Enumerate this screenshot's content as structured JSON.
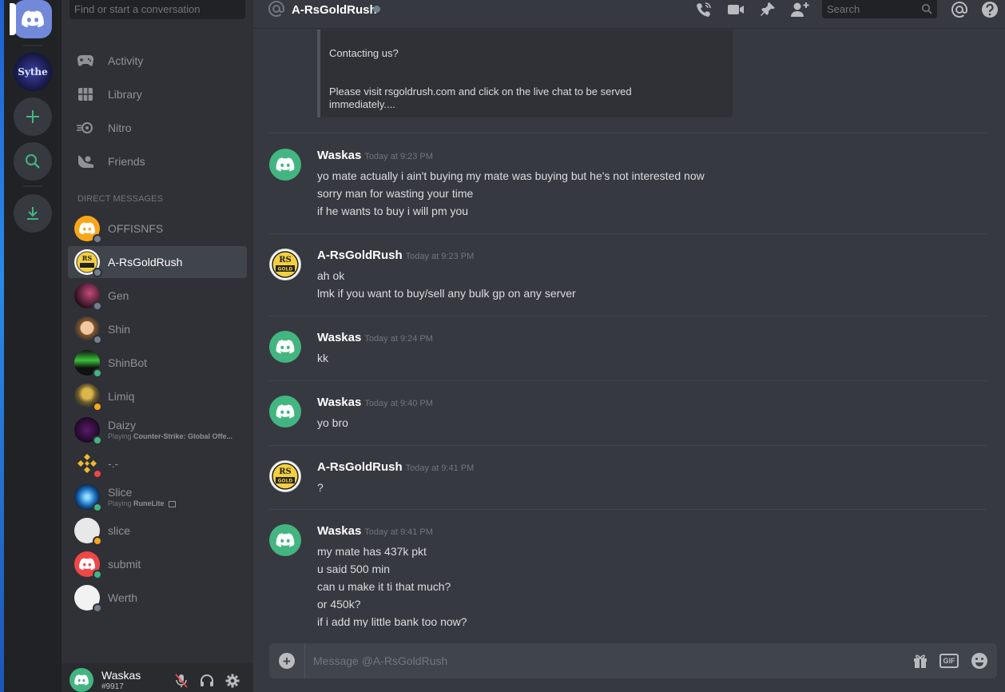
{
  "colors": {
    "accent": "#7289da",
    "online": "#43b581",
    "idle": "#faa61a",
    "dnd": "#f04747",
    "offline": "#747f8d"
  },
  "guilds": {
    "items": [
      {
        "name": "Home",
        "icon": "discord-logo-icon"
      },
      {
        "name": "Sythe",
        "label": "Sythe"
      },
      {
        "name": "Add a Server",
        "icon": "plus-icon"
      },
      {
        "name": "Explore Public Servers",
        "icon": "search-icon"
      },
      {
        "name": "Download Apps",
        "icon": "download-icon"
      }
    ]
  },
  "sidebar": {
    "search_placeholder": "Find or start a conversation",
    "nav": [
      {
        "label": "Activity",
        "icon": "gamepad-icon"
      },
      {
        "label": "Library",
        "icon": "library-icon"
      },
      {
        "label": "Nitro",
        "icon": "nitro-icon"
      },
      {
        "label": "Friends",
        "icon": "friends-icon"
      }
    ],
    "dm_header": "DIRECT MESSAGES",
    "dms": [
      {
        "name": "OFFISNFS",
        "status": "offline"
      },
      {
        "name": "A-RsGoldRush",
        "status": "offline",
        "active": true
      },
      {
        "name": "Gen",
        "status": "offline"
      },
      {
        "name": "Shin",
        "status": "offline"
      },
      {
        "name": "ShinBot",
        "status": "online"
      },
      {
        "name": "Limiq",
        "status": "idle"
      },
      {
        "name": "Daizy",
        "status": "online",
        "activity_prefix": "Playing ",
        "activity": "Counter-Strike: Global Offe..."
      },
      {
        "name": "-.-",
        "status": "dnd"
      },
      {
        "name": "Slice",
        "status": "online",
        "activity_prefix": "Playing ",
        "activity": "RuneLite"
      },
      {
        "name": "slice",
        "status": "idle"
      },
      {
        "name": "submit",
        "status": "online"
      },
      {
        "name": "Werth",
        "status": "offline"
      }
    ]
  },
  "user": {
    "name": "Waskas",
    "tag": "#9917"
  },
  "header": {
    "channel": "A-RsGoldRush",
    "search_placeholder": "Search"
  },
  "embed": {
    "line1": "Contacting us?",
    "line2": "Please visit rsgoldrush.com and click on the live chat to be served immediately...."
  },
  "messages": [
    {
      "author": "Waskas",
      "time": "Today at 9:23 PM",
      "avatar": "discord",
      "lines": [
        "yo mate actually i ain't buying my mate was buying but he's not interested now",
        "sorry man for wasting your time",
        "if he wants to buy i will pm you"
      ]
    },
    {
      "author": "A-RsGoldRush",
      "time": "Today at 9:23 PM",
      "avatar": "rs",
      "lines": [
        "ah ok",
        "lmk if you want to buy/sell any bulk gp on any server"
      ]
    },
    {
      "author": "Waskas",
      "time": "Today at 9:24 PM",
      "avatar": "discord",
      "lines": [
        "kk"
      ]
    },
    {
      "author": "Waskas",
      "time": "Today at 9:40 PM",
      "avatar": "discord",
      "lines": [
        "yo bro"
      ]
    },
    {
      "author": "A-RsGoldRush",
      "time": "Today at 9:41 PM",
      "avatar": "rs",
      "lines": [
        "?"
      ]
    },
    {
      "author": "Waskas",
      "time": "Today at 9:41 PM",
      "avatar": "discord",
      "lines": [
        "my mate has 437k pkt",
        "u said 500 min",
        "can u make it ti that much?",
        "or 450k?",
        "if i add my little bank too now?"
      ]
    }
  ],
  "composer": {
    "placeholder": "Message @A-RsGoldRush",
    "gif_label": "GIF"
  }
}
